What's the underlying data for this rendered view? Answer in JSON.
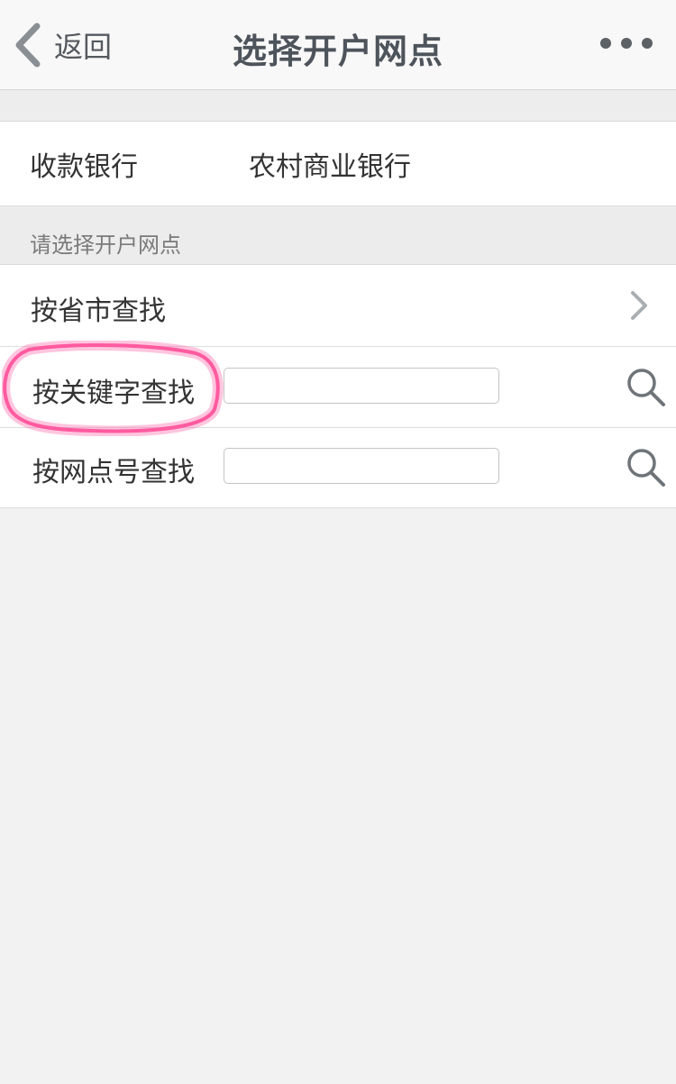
{
  "nav": {
    "back_label": "返回",
    "title": "选择开户网点",
    "more_icon": "more-dots-icon"
  },
  "bank": {
    "label": "收款银行",
    "value": "农村商业银行"
  },
  "section": {
    "header": "请选择开户网点"
  },
  "options": [
    {
      "label": "按省市查找",
      "icon": "chevron-right-icon"
    },
    {
      "label": "按关键字查找",
      "input_value": "",
      "input_placeholder": "",
      "icon": "search-icon"
    },
    {
      "label": "按网点号查找",
      "input_value": "",
      "input_placeholder": "",
      "icon": "search-icon"
    }
  ],
  "annotation": {
    "highlight_color": "#ff5aa0"
  },
  "colors": {
    "background": "#f2f2f2",
    "navbar": "#f8f8f8",
    "icon_gray": "#8a8f94",
    "title_text": "#4e545b"
  }
}
